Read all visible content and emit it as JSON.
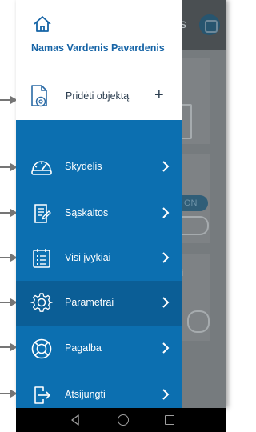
{
  "drawer": {
    "user_name": "Namas Vardenis Pavardenis",
    "add_object_label": "Pridėti objektą",
    "add_object_plus": "+",
    "menu_items": [
      {
        "label": "Skydelis",
        "icon": "dashboard-gauge-icon",
        "active": false
      },
      {
        "label": "Sąskaitos",
        "icon": "invoice-icon",
        "active": false
      },
      {
        "label": "Visi įvykiai",
        "icon": "events-list-icon",
        "active": false
      },
      {
        "label": "Parametrai",
        "icon": "settings-gear-icon",
        "active": true
      },
      {
        "label": "Pagalba",
        "icon": "help-lifebuoy-icon",
        "active": false
      },
      {
        "label": "Atsijungti",
        "icon": "logout-icon",
        "active": false
      }
    ]
  },
  "background_app": {
    "toggle_on_label": "ON",
    "partial_text": "ai",
    "top_partial_text": "s"
  },
  "colors": {
    "drawer_menu_bg": "#0c6fb0",
    "drawer_menu_active_bg": "#0b5e96",
    "user_name_color": "#1664a6"
  }
}
